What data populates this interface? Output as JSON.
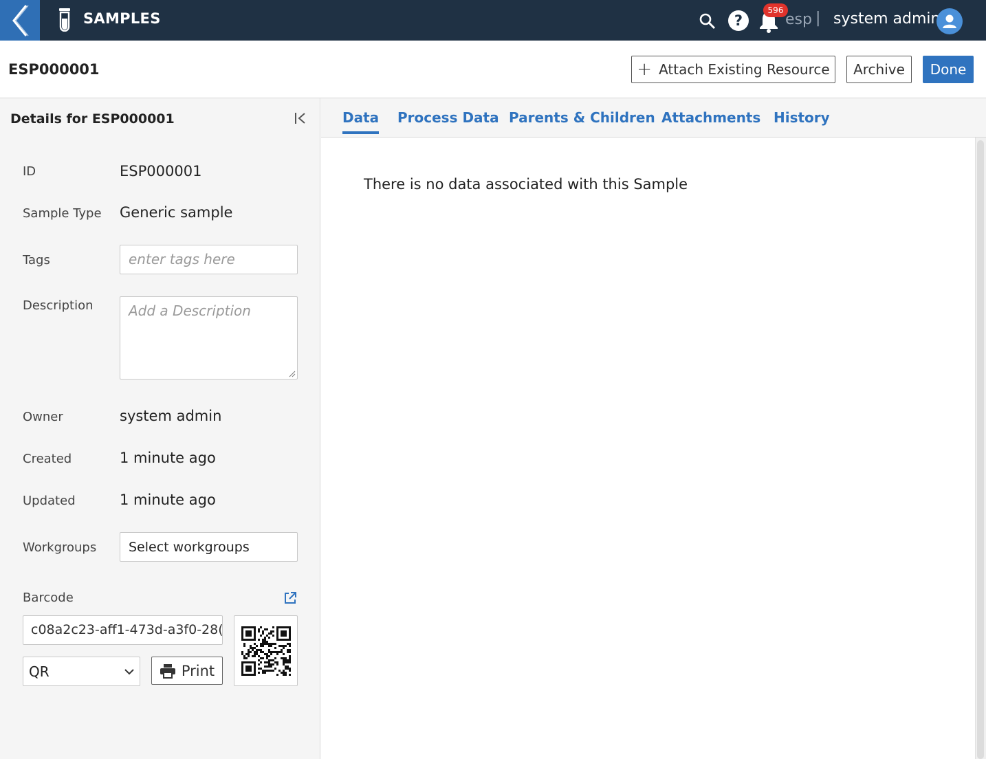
{
  "topbar": {
    "app_title": "SAMPLES",
    "notification_count": "596",
    "tenant": "esp",
    "separator": "|",
    "user_name": "system admin",
    "icons": [
      "back-chevron-icon",
      "test-tube-icon",
      "search-icon",
      "help-icon",
      "bell-icon",
      "user-avatar-icon"
    ],
    "colors": {
      "bar": "#1f3144",
      "back": "#2f6fb5",
      "badge": "#e0332c",
      "avatar": "#4a90d9"
    }
  },
  "header": {
    "title": "ESP000001",
    "attach_label": "Attach Existing Resource",
    "archive_label": "Archive",
    "done_label": "Done",
    "accent_color": "#2f73bf"
  },
  "details": {
    "panel_title": "Details for ESP000001",
    "fields": {
      "id": {
        "label": "ID",
        "value": "ESP000001"
      },
      "sample_type": {
        "label": "Sample Type",
        "value": "Generic sample"
      },
      "tags": {
        "label": "Tags",
        "placeholder": "enter tags here"
      },
      "description": {
        "label": "Description",
        "placeholder": "Add a Description"
      },
      "owner": {
        "label": "Owner",
        "value": "system admin"
      },
      "created": {
        "label": "Created",
        "value": "1 minute ago"
      },
      "updated": {
        "label": "Updated",
        "value": "1 minute ago"
      },
      "workgroups": {
        "label": "Workgroups",
        "value": "Select workgroups"
      }
    },
    "barcode": {
      "label": "Barcode",
      "value": "c08a2c23-aff1-473d-a3f0-28(",
      "type_selected": "QR",
      "print_label": "Print"
    }
  },
  "tabs": [
    "Data",
    "Process Data",
    "Parents & Children",
    "Attachments",
    "History"
  ],
  "active_tab": "Data",
  "content": {
    "empty_message": "There is no data associated with this Sample"
  }
}
